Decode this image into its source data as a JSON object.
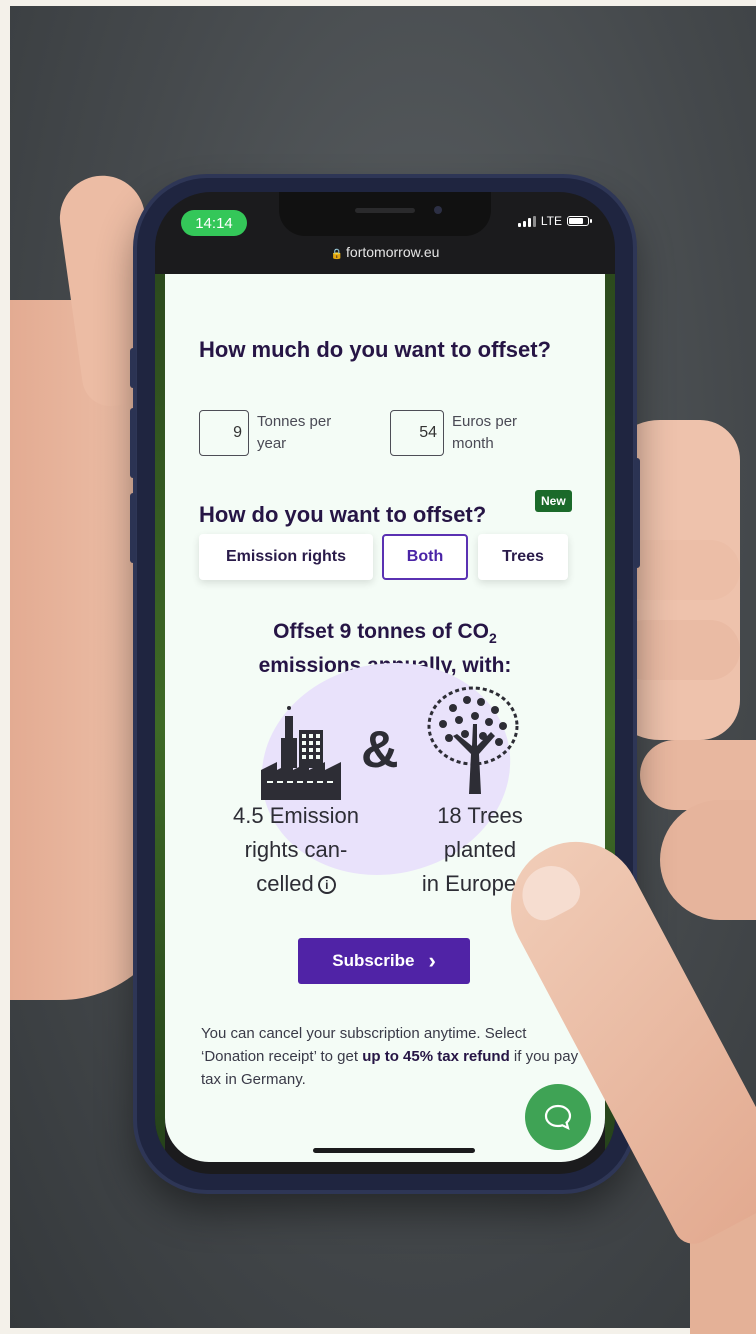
{
  "status_bar": {
    "time": "14:14",
    "network": "LTE"
  },
  "browser": {
    "url": "fortomorrow.eu"
  },
  "amount_section": {
    "heading": "How much do you want to offset?",
    "tonnes_value": "9",
    "tonnes_label": "Tonnes per year",
    "euros_value": "54",
    "euros_label": "Euros per month"
  },
  "method_section": {
    "heading": "How do you want to offset?",
    "badge": "New",
    "options": [
      {
        "label": "Emission rights",
        "selected": false
      },
      {
        "label": "Both",
        "selected": true
      },
      {
        "label": "Trees",
        "selected": false
      }
    ]
  },
  "summary": {
    "title_line1_pre": "Offset 9 tonnes of CO",
    "title_subscript": "2",
    "title_line2": "emissions annually, with:",
    "ampersand": "&",
    "emission_line1": "4.5 Emission",
    "emission_line2": "rights can-",
    "emission_line3": "celled",
    "trees_line1": "18 Trees",
    "trees_line2": "planted",
    "trees_line3": "in Europe",
    "info_glyph": "i"
  },
  "cta": {
    "subscribe_label": "Subscribe",
    "chevron": "›"
  },
  "note": {
    "text1": "You can cancel your subscription anytime. Select ‘Donation receipt’ to get ",
    "bold": "up to 45% tax refund",
    "text2": " if you pay tax in Germany."
  },
  "colors": {
    "accent_purple": "#5023a6",
    "brand_green": "#34c759",
    "badge_green": "#1b6a2a",
    "chat_green": "#3fa355",
    "heading": "#261545"
  },
  "icons": [
    "lock-icon",
    "signal-icon",
    "battery-icon",
    "factory-icon",
    "tree-icon",
    "info-icon",
    "chevron-right-icon",
    "chat-icon"
  ]
}
